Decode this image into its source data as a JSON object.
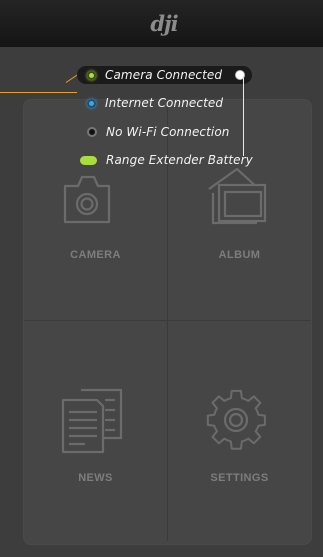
{
  "header": {
    "logo_text": "dji"
  },
  "status": {
    "items": [
      {
        "label": "Camera Connected",
        "indicator": "green-dot",
        "color": "#a9de3c"
      },
      {
        "label": "Internet Connected",
        "indicator": "blue-dot",
        "color": "#39a8e8"
      },
      {
        "label": "No Wi-Fi Connection",
        "indicator": "black-dot",
        "color": "#111111"
      },
      {
        "label": "Range Extender Battery",
        "indicator": "green-pill",
        "color": "#a9de3c"
      }
    ]
  },
  "menu": {
    "tiles": [
      {
        "label": "CAMERA",
        "icon": "camera-icon"
      },
      {
        "label": "ALBUM",
        "icon": "album-icon"
      },
      {
        "label": "NEWS",
        "icon": "news-icon"
      },
      {
        "label": "SETTINGS",
        "icon": "gear-icon"
      }
    ]
  },
  "colors": {
    "accent": "#e2a322",
    "connected": "#a9de3c",
    "internet": "#39a8e8"
  }
}
